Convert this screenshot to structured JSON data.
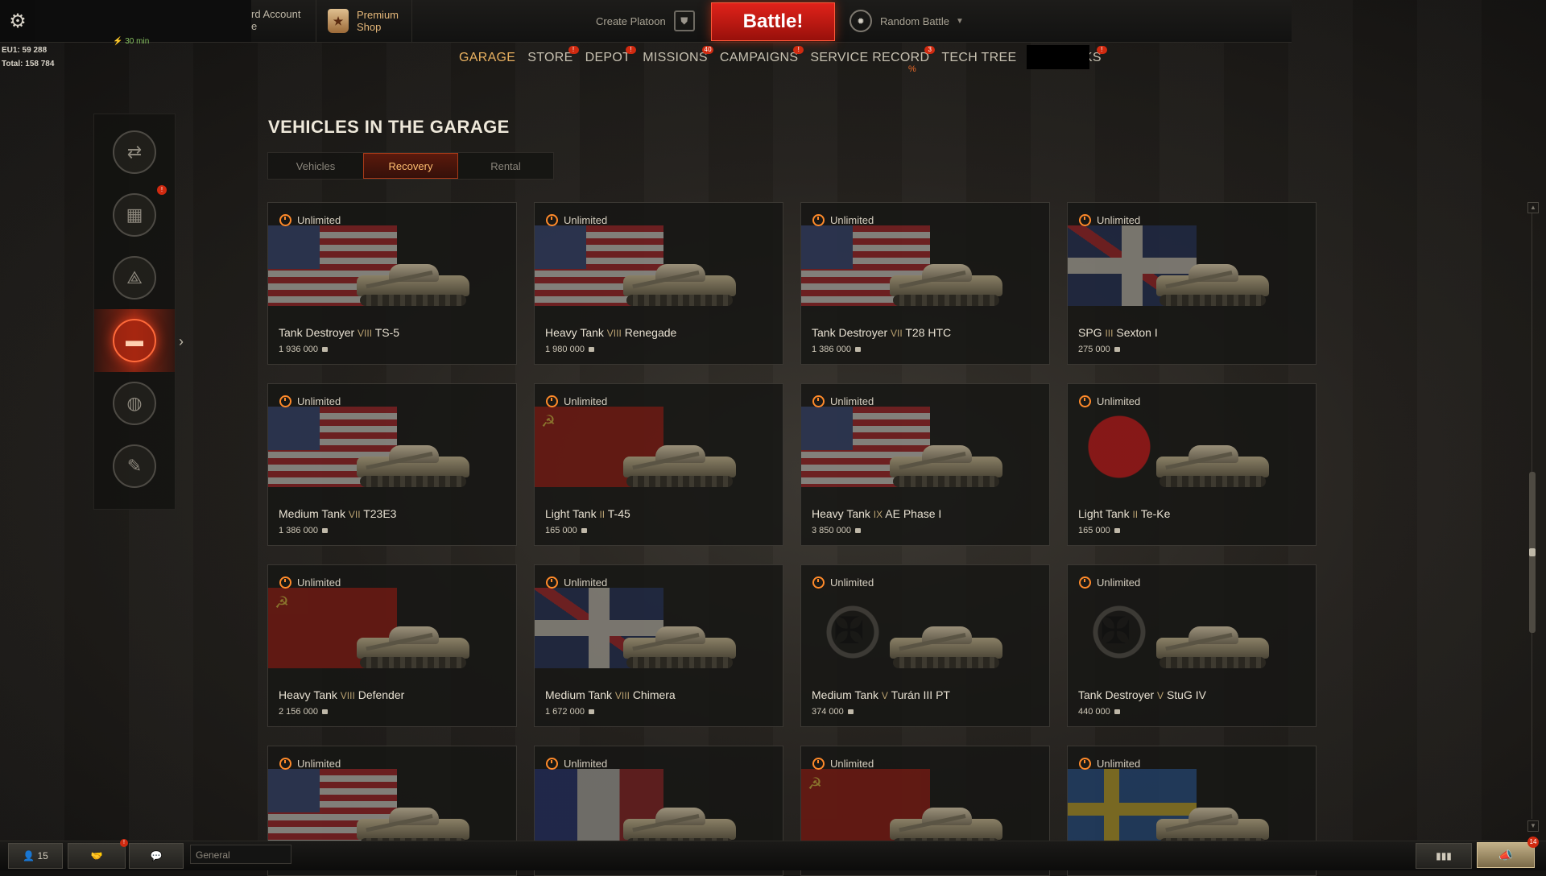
{
  "topbar": {
    "account_fragment": "rd Account\ne",
    "premium_shop_label": "Premium\nShop",
    "create_platoon": "Create Platoon",
    "battle_label": "Battle!",
    "battle_mode": "Random Battle"
  },
  "credits": {
    "eu1": "EU1: 59 288",
    "total": "Total: 158 784",
    "hint": "30 min"
  },
  "nav": [
    {
      "label": "GARAGE",
      "badge": ""
    },
    {
      "label": "STORE",
      "badge": "!"
    },
    {
      "label": "DEPOT",
      "badge": "!"
    },
    {
      "label": "MISSIONS",
      "badge": "40"
    },
    {
      "label": "CAMPAIGNS",
      "badge": "!"
    },
    {
      "label": "SERVICE RECORD",
      "badge": "3"
    },
    {
      "label": "TECH TREE",
      "badge": ""
    },
    {
      "label": "BARRACKS",
      "badge": "!"
    }
  ],
  "nav_active": "GARAGE",
  "tech_tree_mark": "%",
  "side_rail": {
    "badge": "!",
    "items": [
      "exchange-icon",
      "depot-boxes-icon",
      "compass-icon",
      "vehicles-icon",
      "crew-icon",
      "brush-icon"
    ]
  },
  "page": {
    "title": "VEHICLES IN THE GARAGE",
    "tabs": [
      "Vehicles",
      "Recovery",
      "Rental"
    ],
    "active_tab": "Recovery"
  },
  "vehicles": [
    {
      "time": "Unlimited",
      "class": "Tank Destroyer",
      "tier": "VIII",
      "name": "TS-5",
      "price": "1 936 000",
      "nation": "usa"
    },
    {
      "time": "Unlimited",
      "class": "Heavy Tank",
      "tier": "VIII",
      "name": "Renegade",
      "price": "1 980 000",
      "nation": "usa"
    },
    {
      "time": "Unlimited",
      "class": "Tank Destroyer",
      "tier": "VII",
      "name": "T28 HTC",
      "price": "1 386 000",
      "nation": "usa"
    },
    {
      "time": "Unlimited",
      "class": "SPG",
      "tier": "III",
      "name": "Sexton I",
      "price": "275 000",
      "nation": "uk"
    },
    {
      "time": "Unlimited",
      "class": "Medium Tank",
      "tier": "VII",
      "name": "T23E3",
      "price": "1 386 000",
      "nation": "usa"
    },
    {
      "time": "Unlimited",
      "class": "Light Tank",
      "tier": "II",
      "name": "T-45",
      "price": "165 000",
      "nation": "ussr"
    },
    {
      "time": "Unlimited",
      "class": "Heavy Tank",
      "tier": "IX",
      "name": "AE Phase I",
      "price": "3 850 000",
      "nation": "usa"
    },
    {
      "time": "Unlimited",
      "class": "Light Tank",
      "tier": "II",
      "name": "Te-Ke",
      "price": "165 000",
      "nation": "japan"
    },
    {
      "time": "Unlimited",
      "class": "Heavy Tank",
      "tier": "VIII",
      "name": "Defender",
      "price": "2 156 000",
      "nation": "ussr"
    },
    {
      "time": "Unlimited",
      "class": "Medium Tank",
      "tier": "VIII",
      "name": "Chimera",
      "price": "1 672 000",
      "nation": "uk"
    },
    {
      "time": "Unlimited",
      "class": "Medium Tank",
      "tier": "V",
      "name": "Turán III PT",
      "price": "374 000",
      "nation": "germany"
    },
    {
      "time": "Unlimited",
      "class": "Tank Destroyer",
      "tier": "V",
      "name": "StuG IV",
      "price": "440 000",
      "nation": "germany"
    },
    {
      "time": "Unlimited",
      "class": "",
      "tier": "",
      "name": "",
      "price": "",
      "nation": "usa"
    },
    {
      "time": "Unlimited",
      "class": "",
      "tier": "",
      "name": "",
      "price": "",
      "nation": "france"
    },
    {
      "time": "Unlimited",
      "class": "",
      "tier": "",
      "name": "",
      "price": "",
      "nation": "ussr"
    },
    {
      "time": "Unlimited",
      "class": "",
      "tier": "",
      "name": "",
      "price": "",
      "nation": "sweden"
    }
  ],
  "bottombar": {
    "friends_count": "15",
    "contacts_badge": "!",
    "channel": "General",
    "notifications_badge": "14"
  }
}
